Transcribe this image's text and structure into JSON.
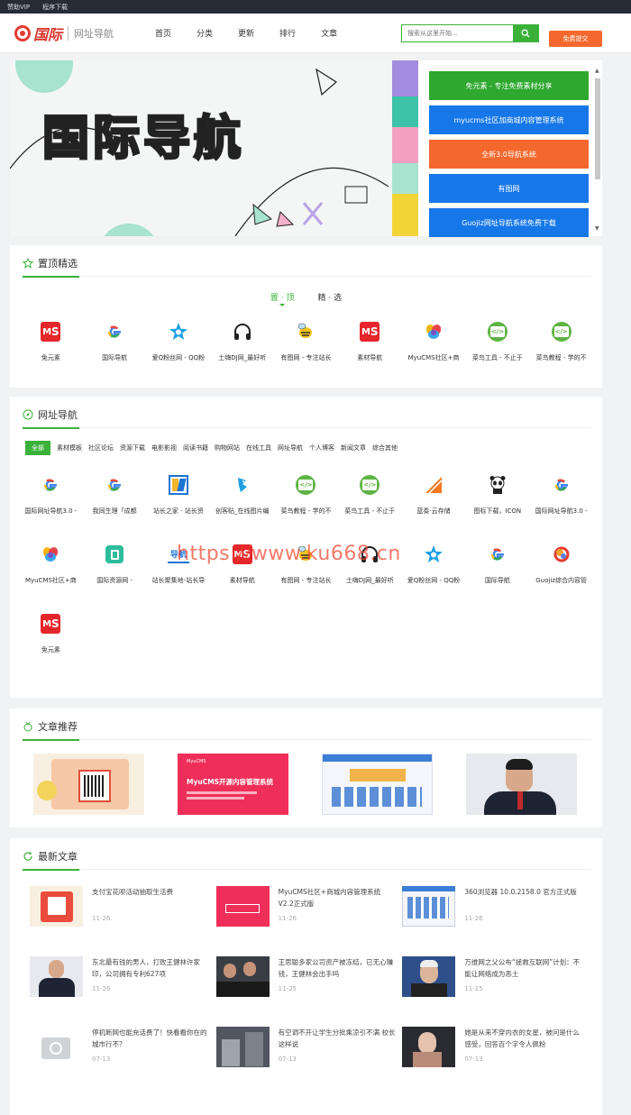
{
  "topbar": {
    "links": [
      "赞助VIP",
      "程序下载"
    ]
  },
  "header": {
    "logo_text": "国际",
    "logo_sub": "网址导航",
    "nav": [
      "首页",
      "分类",
      "更新",
      "排行",
      "文章"
    ],
    "search_placeholder": "搜索从这里开始...",
    "submit_label": "免费提交"
  },
  "banner": {
    "title": "国际导航",
    "quick_links": [
      {
        "label": "免元素 - 专注免费素材分享",
        "color": "#2ea82f"
      },
      {
        "label": "myucms社区加商城内容管理系统",
        "color": "#1677e8"
      },
      {
        "label": "全新3.0导航系统",
        "color": "#f5682d"
      },
      {
        "label": "有图网",
        "color": "#1677e8"
      },
      {
        "label": "Guojiz网址导航系统免费下载",
        "color": "#1677e8"
      }
    ]
  },
  "pinned": {
    "title": "置顶精选",
    "tabs": [
      "置 · 顶",
      "精 · 选"
    ],
    "items": [
      {
        "name": "免元素",
        "icon": "mys-icon"
      },
      {
        "name": "国际导航",
        "icon": "google-g-icon"
      },
      {
        "name": "爱Q粉丝网 - QQ粉",
        "icon": "star-icon"
      },
      {
        "name": "土嗨DJ网_最好听",
        "icon": "headphones-icon"
      },
      {
        "name": "有图网 - 专注站长",
        "icon": "bee-icon"
      },
      {
        "name": "素材导航",
        "icon": "mys-icon"
      },
      {
        "name": "MyuCMS社区+商",
        "icon": "petal-icon"
      },
      {
        "name": "菜鸟工具 - 不止于",
        "icon": "code-icon"
      },
      {
        "name": "菜鸟教程 - 学的不",
        "icon": "code-icon"
      }
    ]
  },
  "directory": {
    "title": "网址导航",
    "categories": [
      "全部",
      "素材模板",
      "社区论坛",
      "资源下载",
      "电影影视",
      "阅读书籍",
      "购物网站",
      "在线工具",
      "网址导航",
      "个人博客",
      "新闻文章",
      "综合其他"
    ],
    "items": [
      {
        "name": "国际网址导航3.0 -",
        "icon": "google-g-icon"
      },
      {
        "name": "我同生理「成都",
        "icon": "google-g-icon"
      },
      {
        "name": "站长之家 - 站长资",
        "icon": "chinaz-icon"
      },
      {
        "name": "创客贴_在线图片编",
        "icon": "blue-bird-icon"
      },
      {
        "name": "菜鸟教程 - 学的不",
        "icon": "code-icon"
      },
      {
        "name": "菜鸟工具 - 不止于",
        "icon": "code-icon"
      },
      {
        "name": "蓝奏·云存储",
        "icon": "lanzou-icon"
      },
      {
        "name": "图标下载，ICON",
        "icon": "panda-icon"
      },
      {
        "name": "国际网址导航3.0 -",
        "icon": "google-g-icon"
      },
      {
        "name": "MyuCMS社区+商",
        "icon": "petal-icon"
      },
      {
        "name": "国际资源网 -",
        "icon": "box-icon"
      },
      {
        "name": "站长聚集地-站长导",
        "icon": "nav-icon"
      },
      {
        "name": "素材导航",
        "icon": "mys-icon"
      },
      {
        "name": "有图网 - 专注站长",
        "icon": "bee-icon"
      },
      {
        "name": "土嗨DJ网_最好听",
        "icon": "headphones-icon"
      },
      {
        "name": "爱Q粉丝网 - QQ粉",
        "icon": "star-icon"
      },
      {
        "name": "国际导航",
        "icon": "google-g-icon"
      },
      {
        "name": "Guojiz综合内容管",
        "icon": "guojiz-icon"
      },
      {
        "name": "免元素",
        "icon": "mys-icon"
      }
    ]
  },
  "recommended": {
    "title": "文章推荐",
    "banner2_title": "MyuCMS开源内容管理系统"
  },
  "latest": {
    "title": "最新文章",
    "items": [
      {
        "title": "支付宝花呗活动抽取生活费",
        "date": "11-26"
      },
      {
        "title": "MyuCMS社区+商城内容管理系统V2.2正式版",
        "date": "11-26"
      },
      {
        "title": "360浏览器 10.0.2158.0 官方正式版",
        "date": "11-26"
      },
      {
        "title": "东北最有钱的男人，打败王健林许家印，公司拥有专利627项",
        "date": "11-26"
      },
      {
        "title": "王思聪多家公司资产被冻结，已无心赚钱，王健林会出手吗",
        "date": "11-25"
      },
      {
        "title": "万维网之父公布“拯救互联网”计划：不能让网络成为恶土",
        "date": "11-25"
      },
      {
        "title": "停机断网也能充话费了！快看看你在的城市行不？",
        "date": "07-13"
      },
      {
        "title": "有空调不开让学生分批乘凉引不满 校长这样说",
        "date": "07-13"
      },
      {
        "title": "她是从来不穿内衣的女星，被问是什么感受，回答百个字令人佩粉",
        "date": "07-13"
      }
    ]
  },
  "watermark": "https://www.ku668.cn"
}
